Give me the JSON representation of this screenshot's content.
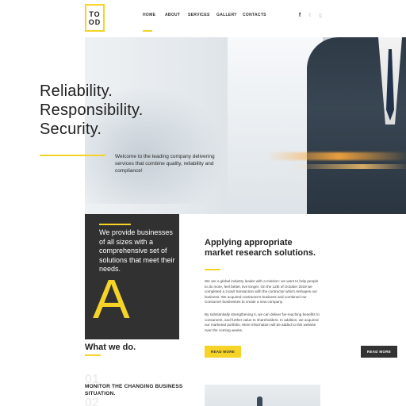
{
  "logo": {
    "line1": "TO",
    "line2": "OD"
  },
  "nav": {
    "items": [
      {
        "label": "HOME"
      },
      {
        "label": "ABOUT"
      },
      {
        "label": "SERVICES"
      },
      {
        "label": "GALLERY"
      },
      {
        "label": "CONTACTS"
      }
    ]
  },
  "social": {
    "facebook": "f",
    "twitter": "t",
    "other": "g"
  },
  "hero": {
    "title_line1": "Reliability.",
    "title_line2": "Responsibility.",
    "title_line3": "Security.",
    "text": "Welcome to the leading company delivering services that combine quality, reliability and compliance!"
  },
  "dark_block": {
    "text": "We provide businesses of all sizes with a comprehensive set of solutions that meet their needs.",
    "letter": "A"
  },
  "market": {
    "title_line1": "Applying appropriate",
    "title_line2": "market research solutions.",
    "para1": "We are a global industry leader with a mission: we want to help people to do more, feel better, live longer. On the 12th of October 2019 we completed a 3-part transaction with the contractor which reshapes our business. We acquired contractor's business and combined our Consumer businesses to create a new company.",
    "para2": "By substantially strengthening it, we can deliver far-reaching benefits to consumers, and further value to shareholders. In addition, we acquired our marketed portfolio. More information will be added to this website over the coming weeks.",
    "read_more": "READ MORE",
    "read_more2": "READ MORE"
  },
  "what": {
    "title": "What we do.",
    "num1": "01",
    "num2": "02",
    "item1": "MONITOR THE CHANGING BUSINESS SITUATION."
  },
  "colors": {
    "accent": "#f5d327",
    "dark": "#313131"
  }
}
